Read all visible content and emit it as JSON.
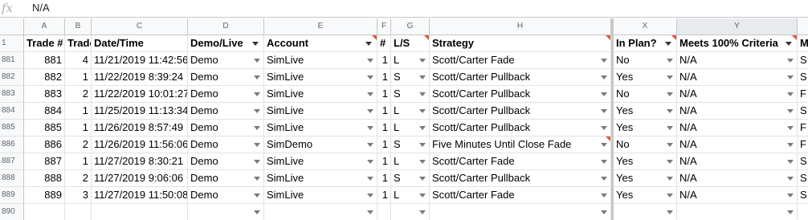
{
  "formula_bar": {
    "fx_label": "fx",
    "value": "N/A"
  },
  "columns": [
    {
      "letter": "",
      "label": "1"
    },
    {
      "letter": "A",
      "label": "Trade #"
    },
    {
      "letter": "B",
      "label": "Trade"
    },
    {
      "letter": "C",
      "label": "Date/Time"
    },
    {
      "letter": "D",
      "label": "Demo/Live"
    },
    {
      "letter": "E",
      "label": "Account"
    },
    {
      "letter": "F",
      "label": "#"
    },
    {
      "letter": "G",
      "label": "L/S"
    },
    {
      "letter": "H",
      "label": "Strategy"
    },
    {
      "letter": "X",
      "label": "In Plan?"
    },
    {
      "letter": "Y",
      "label": "Meets 100% Criteria"
    },
    {
      "letter": "",
      "label": "M"
    }
  ],
  "rows": [
    {
      "rn": "881",
      "a": "881",
      "b": "4",
      "c": "11/21/2019 11:42:56",
      "d": "Demo",
      "e": "SimLive",
      "f": "1",
      "g": "L",
      "h": "Scott/Carter Fade",
      "x": "No",
      "y": "N/A",
      "z": "S"
    },
    {
      "rn": "882",
      "a": "882",
      "b": "1",
      "c": "11/22/2019 8:39:24",
      "d": "Demo",
      "e": "SimLive",
      "f": "1",
      "g": "S",
      "h": "Scott/Carter Pullback",
      "x": "Yes",
      "y": "N/A",
      "z": "S"
    },
    {
      "rn": "883",
      "a": "883",
      "b": "2",
      "c": "11/22/2019 10:01:27",
      "d": "Demo",
      "e": "SimLive",
      "f": "1",
      "g": "S",
      "h": "Scott/Carter Pullback",
      "x": "No",
      "y": "N/A",
      "z": "F"
    },
    {
      "rn": "884",
      "a": "884",
      "b": "1",
      "c": "11/25/2019 11:13:34",
      "d": "Demo",
      "e": "SimLive",
      "f": "1",
      "g": "L",
      "h": "Scott/Carter Pullback",
      "x": "Yes",
      "y": "N/A",
      "z": "S"
    },
    {
      "rn": "885",
      "a": "885",
      "b": "1",
      "c": "11/26/2019 8:57:49",
      "d": "Demo",
      "e": "SimLive",
      "f": "1",
      "g": "L",
      "h": "Scott/Carter Pullback",
      "x": "Yes",
      "y": "N/A",
      "z": "F"
    },
    {
      "rn": "886",
      "a": "886",
      "b": "2",
      "c": "11/26/2019 11:56:06",
      "d": "Demo",
      "e": "SimDemo",
      "f": "1",
      "g": "S",
      "h": "Five Minutes Until Close Fade",
      "x": "No",
      "y": "N/A",
      "z": "F"
    },
    {
      "rn": "887",
      "a": "887",
      "b": "1",
      "c": "11/27/2019 8:30:21",
      "d": "Demo",
      "e": "SimLive",
      "f": "1",
      "g": "L",
      "h": "Scott/Carter Fade",
      "x": "Yes",
      "y": "N/A",
      "z": "S"
    },
    {
      "rn": "888",
      "a": "888",
      "b": "2",
      "c": "11/27/2019 9:06:06",
      "d": "Demo",
      "e": "SimLive",
      "f": "1",
      "g": "S",
      "h": "Scott/Carter Pullback",
      "x": "Yes",
      "y": "N/A",
      "z": "S"
    },
    {
      "rn": "889",
      "a": "889",
      "b": "3",
      "c": "11/27/2019 11:50:08",
      "d": "Demo",
      "e": "SimLive",
      "f": "1",
      "g": "L",
      "h": "Scott/Carter Fade",
      "x": "Yes",
      "y": "N/A",
      "z": "S"
    },
    {
      "rn": "890",
      "a": "",
      "b": "",
      "c": "",
      "d": "",
      "e": "",
      "f": "",
      "g": "",
      "h": "",
      "x": "",
      "y": "",
      "z": ""
    }
  ],
  "colors": {
    "header_bg": "#f8f9fa",
    "note_marker": "#e0533a",
    "grid_line": "#e2e2e2"
  }
}
